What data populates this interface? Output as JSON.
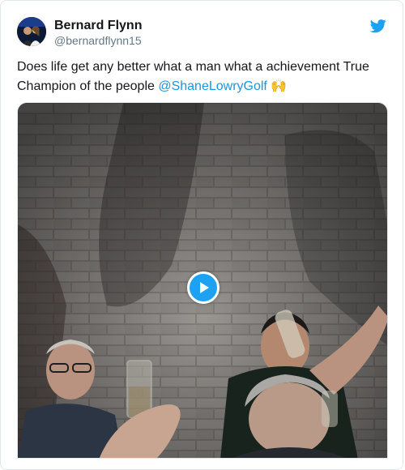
{
  "tweet": {
    "author": {
      "display_name": "Bernard Flynn",
      "handle": "@bernardflynn15",
      "avatar_icon": "avatar-photo"
    },
    "text_before": "Does life get any better what a man what a achievement True Champion of the people ",
    "mention": "@ShaneLowryGolf",
    "emoji": "🙌",
    "brand_icon": "twitter-bird-icon",
    "media": {
      "type": "video",
      "control_icon": "play-icon"
    }
  },
  "colors": {
    "accent": "#1da1f2",
    "link": "#1b95e0",
    "text": "#14171a",
    "muted": "#657786",
    "border": "#e1e8ed"
  }
}
